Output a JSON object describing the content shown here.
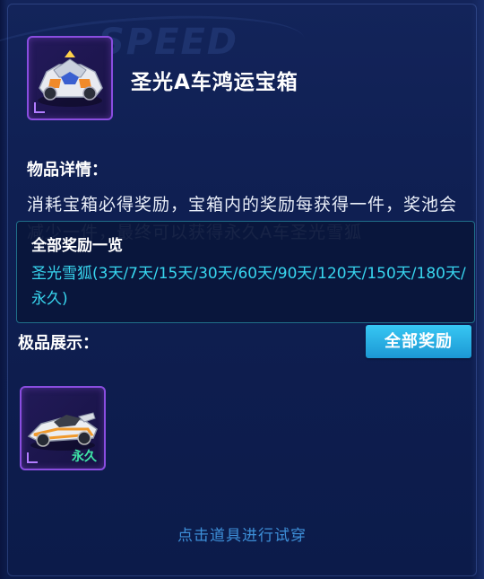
{
  "background_watermark": "SPEED",
  "item": {
    "title": "圣光A车鸿运宝箱",
    "icon": "treasure-car-icon"
  },
  "details": {
    "label": "物品详情：",
    "description": "消耗宝箱必得奖励，宝箱内的奖励每获得一件，奖池会减少一件，最终可以获得永久A车圣光雪狐"
  },
  "tooltip": {
    "title": "全部奖励一览",
    "reward_text": "圣光雪狐(3天/7天/15天/30天/60天/90天/120天/150天/180天/永久)"
  },
  "showcase": {
    "label": "极品展示：",
    "all_rewards_button": "全部奖励",
    "items": [
      {
        "icon": "race-car-icon",
        "duration": "永久"
      }
    ]
  },
  "hint": "点击道具进行试穿",
  "colors": {
    "background": "#13245a",
    "accent_cyan": "#38d6ef",
    "button": "#1c98d4",
    "frame_purple": "#8a4de0",
    "badge_green": "#3fe6a8",
    "hint_blue": "#3d8fd8"
  }
}
